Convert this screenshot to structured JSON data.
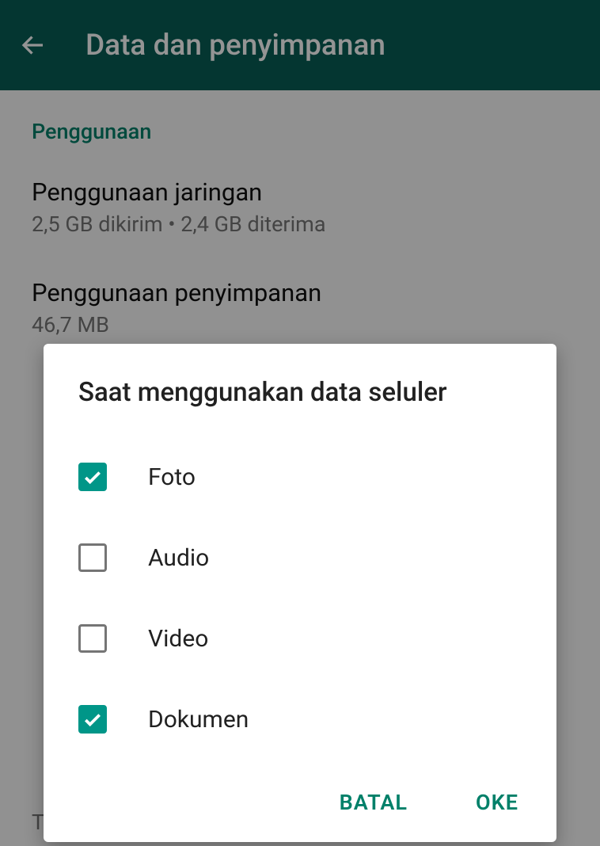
{
  "header": {
    "title": "Data dan penyimpanan"
  },
  "section": {
    "header": "Penggunaan",
    "items": [
      {
        "title": "Penggunaan jaringan",
        "subtitle": "2,5 GB dikirim • 2,4 GB diterima"
      },
      {
        "title": "Penggunaan penyimpanan",
        "subtitle": "46,7 MB"
      }
    ]
  },
  "dialog": {
    "title": "Saat menggunakan data seluler",
    "options": [
      {
        "label": "Foto",
        "checked": true
      },
      {
        "label": "Audio",
        "checked": false
      },
      {
        "label": "Video",
        "checked": false
      },
      {
        "label": "Dokumen",
        "checked": true
      }
    ],
    "cancel": "BATAL",
    "ok": "OKE"
  },
  "truncated": "Tidak ada media"
}
